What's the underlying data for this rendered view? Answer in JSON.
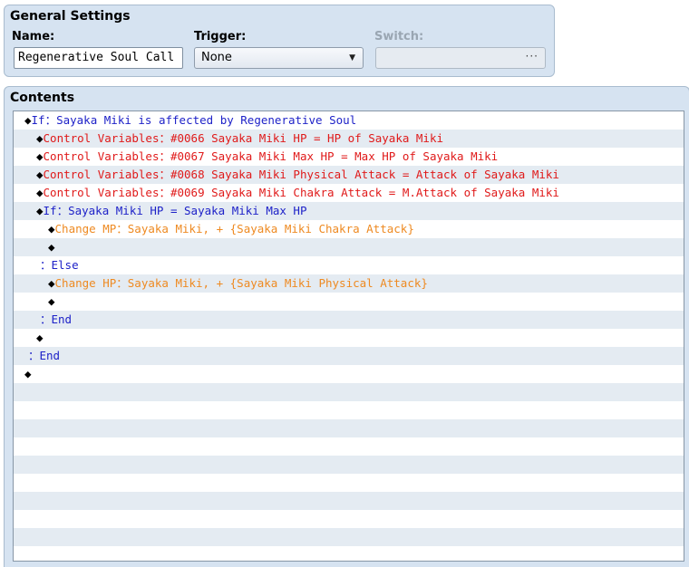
{
  "general": {
    "title": "General Settings",
    "name_label": "Name:",
    "name_value": "Regenerative Soul Call",
    "trigger_label": "Trigger:",
    "trigger_value": "None",
    "switch_label": "Switch:",
    "switch_button": "···"
  },
  "contents": {
    "title": "Contents",
    "lines": [
      {
        "indent": 0,
        "prefix": "◆",
        "text": "If：Sayaka Miki is affected by Regenerative Soul",
        "color": "blue"
      },
      {
        "indent": 1,
        "prefix": "◆",
        "text": "Control Variables：#0066 Sayaka Miki HP = HP of Sayaka Miki",
        "color": "red"
      },
      {
        "indent": 1,
        "prefix": "◆",
        "text": "Control Variables：#0067 Sayaka Miki Max HP = Max HP of Sayaka Miki",
        "color": "red"
      },
      {
        "indent": 1,
        "prefix": "◆",
        "text": "Control Variables：#0068 Sayaka Miki Physical Attack = Attack of Sayaka Miki",
        "color": "red"
      },
      {
        "indent": 1,
        "prefix": "◆",
        "text": "Control Variables：#0069 Sayaka Miki Chakra Attack = M.Attack of Sayaka Miki",
        "color": "red"
      },
      {
        "indent": 1,
        "prefix": "◆",
        "text": "If：Sayaka Miki HP = Sayaka Miki Max HP",
        "color": "blue"
      },
      {
        "indent": 2,
        "prefix": "◆",
        "text": "Change MP：Sayaka Miki, + {Sayaka Miki Chakra Attack}",
        "color": "orange"
      },
      {
        "indent": 2,
        "prefix": "◆",
        "text": "",
        "color": "black"
      },
      {
        "indent": 1,
        "prefix": "",
        "text": "：Else",
        "color": "blue"
      },
      {
        "indent": 2,
        "prefix": "◆",
        "text": "Change HP：Sayaka Miki, + {Sayaka Miki Physical Attack}",
        "color": "orange"
      },
      {
        "indent": 2,
        "prefix": "◆",
        "text": "",
        "color": "black"
      },
      {
        "indent": 1,
        "prefix": "",
        "text": "：End",
        "color": "blue"
      },
      {
        "indent": 1,
        "prefix": "◆",
        "text": "",
        "color": "black"
      },
      {
        "indent": 0,
        "prefix": "",
        "text": "：End",
        "color": "blue"
      },
      {
        "indent": 0,
        "prefix": "◆",
        "text": "",
        "color": "black"
      }
    ]
  }
}
